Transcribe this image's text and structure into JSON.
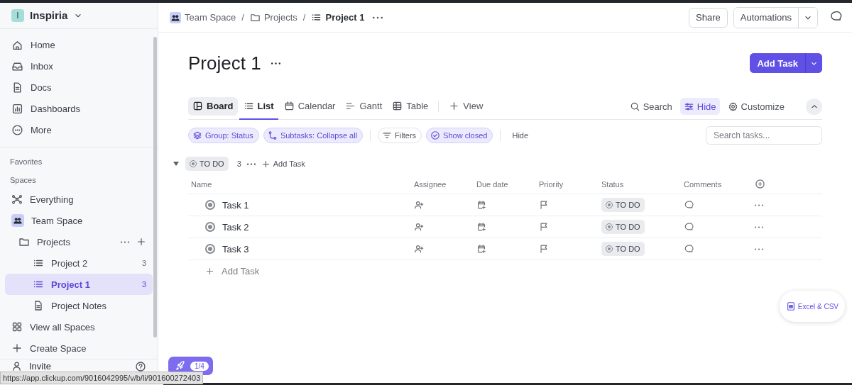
{
  "workspace": {
    "initial": "I",
    "name": "Inspiria"
  },
  "nav": [
    {
      "label": "Home"
    },
    {
      "label": "Inbox"
    },
    {
      "label": "Docs"
    },
    {
      "label": "Dashboards"
    },
    {
      "label": "More"
    }
  ],
  "favorites_label": "Favorites",
  "spaces_label": "Spaces",
  "spaces": [
    {
      "kind": "everything",
      "label": "Everything"
    },
    {
      "kind": "space",
      "label": "Team Space",
      "children": [
        {
          "kind": "folder",
          "label": "Projects",
          "children": [
            {
              "kind": "list",
              "label": "Project 2",
              "count": "3",
              "selected": false
            },
            {
              "kind": "list",
              "label": "Project 1",
              "count": "3",
              "selected": true
            },
            {
              "kind": "doc",
              "label": "Project Notes"
            }
          ]
        }
      ]
    },
    {
      "kind": "grid",
      "label": "View all Spaces"
    },
    {
      "kind": "create",
      "label": "Create Space"
    }
  ],
  "invite": "Invite",
  "breadcrumb": [
    {
      "label": "Team Space"
    },
    {
      "separator": "/"
    },
    {
      "label": "Projects"
    },
    {
      "separator": "/"
    },
    {
      "label": "Project 1"
    }
  ],
  "share": "Share",
  "automations": "Automations",
  "title": "Project 1",
  "add_task": "Add Task",
  "views": [
    {
      "label": "Board",
      "selected": false,
      "highlighted": true
    },
    {
      "label": "List",
      "selected": true,
      "highlighted": false
    },
    {
      "label": "Calendar",
      "selected": false,
      "highlighted": false
    },
    {
      "label": "Gantt",
      "selected": false,
      "highlighted": false
    },
    {
      "label": "Table",
      "selected": false,
      "highlighted": false
    }
  ],
  "add_view": "View",
  "view_tools": [
    {
      "label": "Search",
      "active": false
    },
    {
      "label": "Hide",
      "active": true
    },
    {
      "label": "Customize",
      "active": false
    }
  ],
  "filters": [
    {
      "label": "Group: Status",
      "active": true
    },
    {
      "label": "Subtasks: Collapse all",
      "active": true
    },
    {
      "label": "Filters",
      "active": false
    },
    {
      "label": "Show closed",
      "active": true
    }
  ],
  "hide_label": "Hide",
  "search": {
    "placeholder": "Search tasks..."
  },
  "group": {
    "status": "TO DO",
    "count": "3",
    "add": "Add Task",
    "expanded": true
  },
  "columns": [
    "Name",
    "Assignee",
    "Due date",
    "Priority",
    "Status",
    "Comments"
  ],
  "tasks": [
    {
      "name": "Task 1",
      "status": "TO DO"
    },
    {
      "name": "Task 2",
      "status": "TO DO"
    },
    {
      "name": "Task 3",
      "status": "TO DO"
    }
  ],
  "add_task_row": "Add Task",
  "onboarding": {
    "progress": "1/4"
  },
  "export": "Excel & CSV",
  "status_url": "https://app.clickup.com/9016042995/v/b/li/901600272403"
}
